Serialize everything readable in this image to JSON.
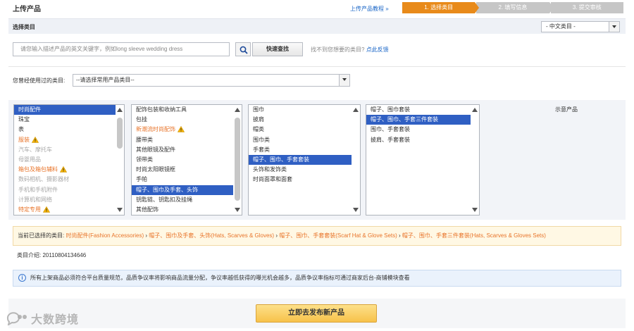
{
  "page": {
    "title": "上传产品",
    "tutorial_link": "上传产品教程 »",
    "steps": [
      "1. 选择类目",
      "2. 填写信息",
      "3. 提交审核"
    ]
  },
  "select_category": {
    "label": "选择类目",
    "language": "- 中文类目 -"
  },
  "search": {
    "placeholder": "请您输入描述产品的英文关键字，例如long sleeve wedding dress",
    "button": "快速查找",
    "not_found": "找不到您想要的类目?",
    "feedback": "点此反馈"
  },
  "used_category": {
    "label": "您曾经使用过的类目:",
    "placeholder": "--请选择常用产品类目--"
  },
  "columns": [
    {
      "items": [
        {
          "text": "时尚配件",
          "style": "sel"
        },
        {
          "text": "珠宝",
          "style": ""
        },
        {
          "text": "表",
          "style": ""
        },
        {
          "text": "服装",
          "style": "orange",
          "warn": true
        },
        {
          "text": "汽车、摩托车",
          "style": "grey"
        },
        {
          "text": "母婴用品",
          "style": "grey"
        },
        {
          "text": "箱包及箱包辅料",
          "style": "orange",
          "warn": true
        },
        {
          "text": "数码相机、摄影器材",
          "style": "grey"
        },
        {
          "text": "手机和手机附件",
          "style": "grey"
        },
        {
          "text": "计算机和网络",
          "style": "grey"
        },
        {
          "text": "特定专用",
          "style": "orange",
          "warn": true
        }
      ]
    },
    {
      "items": [
        {
          "text": "配饰包装和收纳工具",
          "style": ""
        },
        {
          "text": "包挂",
          "style": ""
        },
        {
          "text": "新潮流时尚配饰",
          "style": "orange",
          "warn": true
        },
        {
          "text": "腰带类",
          "style": ""
        },
        {
          "text": "其他眼镜及配件",
          "style": ""
        },
        {
          "text": "领带类",
          "style": ""
        },
        {
          "text": "时尚太阳眼镜框",
          "style": ""
        },
        {
          "text": "手帕",
          "style": ""
        },
        {
          "text": "帽子、围巾及手套、头饰",
          "style": "sel"
        },
        {
          "text": "钥匙链、钥匙扣及挂绳",
          "style": ""
        },
        {
          "text": "其他配饰",
          "style": ""
        }
      ]
    },
    {
      "items": [
        {
          "text": "围巾",
          "style": ""
        },
        {
          "text": "披肩",
          "style": ""
        },
        {
          "text": "帽类",
          "style": ""
        },
        {
          "text": "围巾类",
          "style": ""
        },
        {
          "text": "手套类",
          "style": ""
        },
        {
          "text": "帽子、围巾、手套套装",
          "style": "sel"
        },
        {
          "text": "头饰和发饰类",
          "style": ""
        },
        {
          "text": "时尚面罩和面套",
          "style": ""
        }
      ]
    },
    {
      "items": [
        {
          "text": "帽子、围巾套装",
          "style": ""
        },
        {
          "text": "帽子、围巾、手套三件套装",
          "style": "sel"
        },
        {
          "text": "围巾、手套套装",
          "style": ""
        },
        {
          "text": "披肩、手套套装",
          "style": ""
        }
      ]
    }
  ],
  "sample_product_label": "示意产品",
  "current_path": {
    "label": "当前已选择的类目:",
    "segments": [
      "时尚配件(Fashion Accessories)",
      "帽子、围巾及手套、头饰(Hats, Scarves & Gloves)",
      "帽子、围巾、手套套装(Scarf Hat & Glove Sets)",
      "帽子、围巾、手套三件套装(Hats, Scarves & Gloves Sets)"
    ],
    "separator": " › "
  },
  "category_intro": {
    "label": "类目介绍:",
    "value": "20110804134646"
  },
  "notice": "所有上架商品必须符合平台质量规范，品质争议率将影响商品流量分配，争议率越低获得的曝光机会越多，品质争议率指标可通过商家后台-商铺模块查看",
  "publish_button": "立即去发布新产品",
  "watermark": "大数跨境",
  "colors": {
    "active_step": "#e88a1a",
    "inactive_step": "#c6c6c6",
    "selection": "#2f5fc3",
    "orange_text": "#e8742a",
    "link": "#1a66c7",
    "button_gold": "#f7c24a"
  }
}
